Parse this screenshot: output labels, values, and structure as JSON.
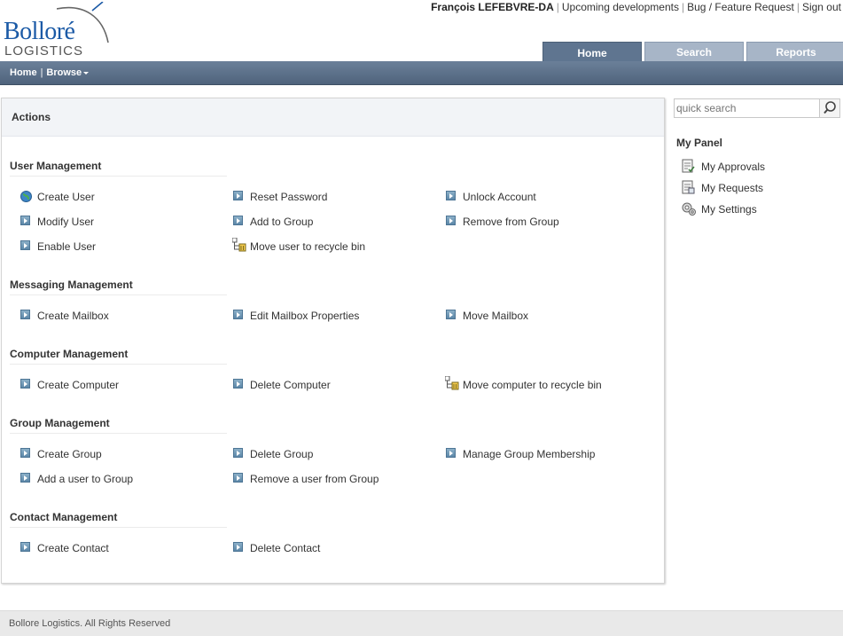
{
  "logo": {
    "line1": "Bolloré",
    "line2": "LOGISTICS"
  },
  "header": {
    "user": "François LEFEBVRE-DA",
    "links": [
      "Upcoming developments",
      "Bug / Feature Request",
      "Sign out"
    ]
  },
  "tabs": [
    {
      "label": "Home",
      "active": true
    },
    {
      "label": "Search",
      "active": false
    },
    {
      "label": "Reports",
      "active": false
    }
  ],
  "nav": {
    "home": "Home",
    "browse": "Browse"
  },
  "actions_panel": {
    "title": "Actions",
    "sections": [
      {
        "title": "User Management",
        "items": [
          {
            "label": "Create User",
            "icon": "globe-icon"
          },
          {
            "label": "Reset Password",
            "icon": "arrow-icon"
          },
          {
            "label": "Unlock Account",
            "icon": "arrow-icon"
          },
          {
            "label": "Modify User",
            "icon": "arrow-icon"
          },
          {
            "label": "Add to Group",
            "icon": "arrow-icon"
          },
          {
            "label": "Remove from Group",
            "icon": "arrow-icon"
          },
          {
            "label": "Enable User",
            "icon": "arrow-icon"
          },
          {
            "label": "Move user to recycle bin",
            "icon": "recycle-icon"
          }
        ]
      },
      {
        "title": "Messaging Management",
        "items": [
          {
            "label": "Create Mailbox",
            "icon": "arrow-icon"
          },
          {
            "label": "Edit Mailbox Properties",
            "icon": "arrow-icon"
          },
          {
            "label": "Move Mailbox",
            "icon": "arrow-icon"
          }
        ]
      },
      {
        "title": "Computer Management",
        "items": [
          {
            "label": "Create Computer",
            "icon": "arrow-icon"
          },
          {
            "label": "Delete Computer",
            "icon": "arrow-icon"
          },
          {
            "label": "Move computer to recycle bin",
            "icon": "recycle-icon"
          }
        ]
      },
      {
        "title": "Group Management",
        "items": [
          {
            "label": "Create Group",
            "icon": "arrow-icon"
          },
          {
            "label": "Delete Group",
            "icon": "arrow-icon"
          },
          {
            "label": "Manage Group Membership",
            "icon": "arrow-icon"
          },
          {
            "label": "Add a user to Group",
            "icon": "arrow-icon"
          },
          {
            "label": "Remove a user from Group",
            "icon": "arrow-icon"
          }
        ]
      },
      {
        "title": "Contact Management",
        "items": [
          {
            "label": "Create Contact",
            "icon": "arrow-icon"
          },
          {
            "label": "Delete Contact",
            "icon": "arrow-icon"
          }
        ]
      }
    ]
  },
  "quick_search": {
    "placeholder": "quick search"
  },
  "my_panel": {
    "title": "My Panel",
    "items": [
      {
        "label": "My Approvals",
        "icon": "approvals-icon"
      },
      {
        "label": "My Requests",
        "icon": "requests-icon"
      },
      {
        "label": "My Settings",
        "icon": "settings-icon"
      }
    ]
  },
  "footer": {
    "text": "Bollore Logistics. All Rights Reserved"
  },
  "colors": {
    "brand_blue": "#1b5aa6",
    "navbar": "#5f7590",
    "tab": "#a7b5c7"
  }
}
